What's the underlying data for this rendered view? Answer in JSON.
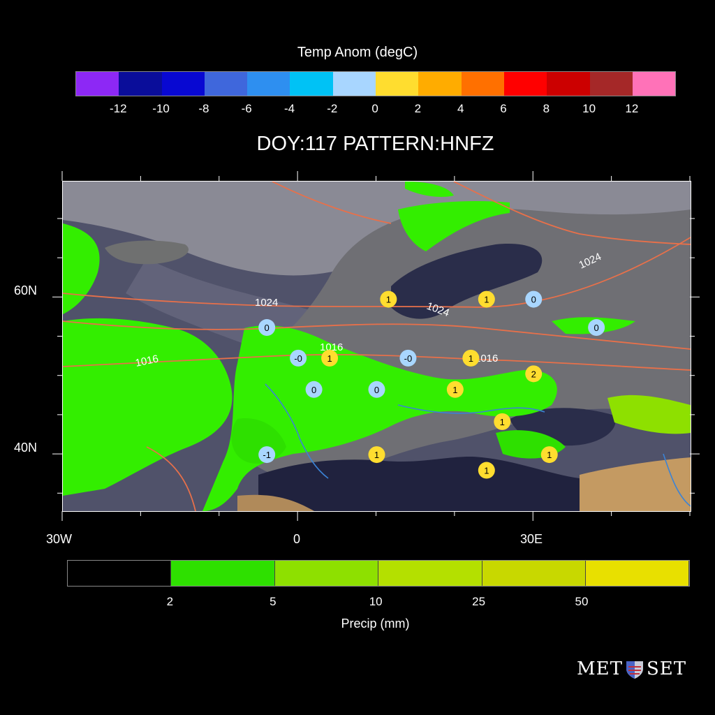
{
  "temp_legend": {
    "title": "Temp Anom (degC)",
    "colors": [
      "#8d28f5",
      "#0a0d9a",
      "#0808d2",
      "#3f67dc",
      "#2e8ff0",
      "#00c2f5",
      "#a8d6ff",
      "#ffdd2f",
      "#ffac00",
      "#ff7000",
      "#ff0000",
      "#cc0000",
      "#a52828",
      "#ff72b8"
    ],
    "labels": [
      "-12",
      "-10",
      "-8",
      "-6",
      "-4",
      "-2",
      "0",
      "2",
      "4",
      "6",
      "8",
      "10",
      "12"
    ]
  },
  "map_title": "DOY:117 PATTERN:HNFZ",
  "axes": {
    "lat_labels": [
      "60N",
      "40N"
    ],
    "lon_labels": [
      "30W",
      "0",
      "30E"
    ]
  },
  "isobars": [
    "1024",
    "1024",
    "1024",
    "1016",
    "1016",
    "1016"
  ],
  "stations": [
    {
      "value": "1",
      "lon": 11.5,
      "lat": 59.8,
      "kind": "warm"
    },
    {
      "value": "1",
      "lon": 24,
      "lat": 59.8,
      "kind": "warm"
    },
    {
      "value": "0",
      "lon": 30,
      "lat": 59.8,
      "kind": "cool"
    },
    {
      "value": "0",
      "lon": -4,
      "lat": 56.2,
      "kind": "cool"
    },
    {
      "value": "0",
      "lon": 38,
      "lat": 56.2,
      "kind": "cool"
    },
    {
      "value": "-0",
      "lon": 0,
      "lat": 52.3,
      "kind": "cool"
    },
    {
      "value": "1",
      "lon": 4,
      "lat": 52.3,
      "kind": "warm"
    },
    {
      "value": "-0",
      "lon": 14,
      "lat": 52.3,
      "kind": "cool"
    },
    {
      "value": "1",
      "lon": 22,
      "lat": 52.3,
      "kind": "warm"
    },
    {
      "value": "2",
      "lon": 30,
      "lat": 50.3,
      "kind": "warm"
    },
    {
      "value": "0",
      "lon": 2,
      "lat": 48.3,
      "kind": "cool"
    },
    {
      "value": "0",
      "lon": 10,
      "lat": 48.3,
      "kind": "cool"
    },
    {
      "value": "1",
      "lon": 20,
      "lat": 48.3,
      "kind": "warm"
    },
    {
      "value": "1",
      "lon": 26,
      "lat": 44.2,
      "kind": "warm"
    },
    {
      "value": "-1",
      "lon": -4,
      "lat": 40,
      "kind": "cool"
    },
    {
      "value": "1",
      "lon": 10,
      "lat": 40,
      "kind": "warm"
    },
    {
      "value": "1",
      "lon": 32,
      "lat": 40,
      "kind": "warm"
    },
    {
      "value": "1",
      "lon": 24,
      "lat": 38,
      "kind": "warm"
    }
  ],
  "precip_legend": {
    "title": "Precip (mm)",
    "colors": [
      "#000000",
      "#33ee00",
      "#2ee000",
      "#8ee000",
      "#b4e000",
      "#c8d800",
      "#e8e000"
    ],
    "labels": [
      "2",
      "5",
      "10",
      "25",
      "50"
    ]
  },
  "logo": {
    "left": "MET",
    "right": "SET"
  },
  "colors": {
    "warm": "#ffdd2f",
    "cool": "#a8d6ff",
    "isobar": "#e8704a",
    "land_gray": "#6f6f74",
    "sea_dark": "#2a2d4a",
    "precip_green": "#33ee00"
  }
}
